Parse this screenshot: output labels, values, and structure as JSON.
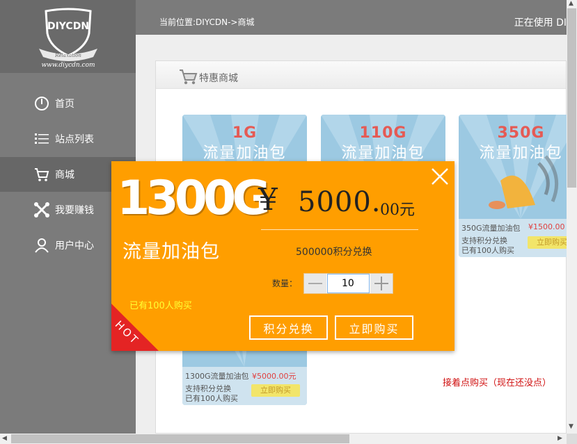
{
  "logo": {
    "text": "DIYCDN",
    "ribbon": "Relaxation",
    "url": "www.diycdn.com"
  },
  "sidebar": {
    "items": [
      {
        "label": "首页",
        "icon": "power-icon"
      },
      {
        "label": "站点列表",
        "icon": "list-icon"
      },
      {
        "label": "商城",
        "icon": "cart-icon"
      },
      {
        "label": "我要赚钱",
        "icon": "tools-icon"
      },
      {
        "label": "用户中心",
        "icon": "user-icon"
      }
    ],
    "active_index": 2
  },
  "header": {
    "breadcrumb": "当前位置:DIYCDN->商城",
    "user_status": "正在使用 DI"
  },
  "panel": {
    "title": "特惠商城"
  },
  "cards": [
    {
      "size": "1G",
      "name": "流量加油包"
    },
    {
      "size": "110G",
      "name": "流量加油包"
    },
    {
      "size": "350G",
      "name": "流量加油包",
      "info_name": "350G流量加油包",
      "info_price": "¥1500.00",
      "exchange": "支持积分兑换",
      "sold": "已有100人购买",
      "buy": "立即购买"
    },
    {
      "info_name": "1300G流量加油包",
      "info_price": "¥5000.00元",
      "exchange": "支持积分兑换",
      "sold": "已有100人购买",
      "buy": "立即购买"
    }
  ],
  "note": "接着点购买（现在还没点）",
  "modal": {
    "size": "1300G",
    "name": "流量加油包",
    "sold": "已有100人购买",
    "currency": "¥",
    "price_main": "5000.",
    "price_dec": "00元",
    "points": "500000积分兑换",
    "qty_label": "数量：",
    "qty_value": "10",
    "btn_exchange": "积分兑换",
    "btn_buy": "立即购买",
    "hot": "HOT"
  },
  "colors": {
    "sidebar": "#7b7b7b",
    "modal": "#ff9e00",
    "hot": "#e42424",
    "card": "#9cc9e2",
    "note": "#d01010"
  }
}
